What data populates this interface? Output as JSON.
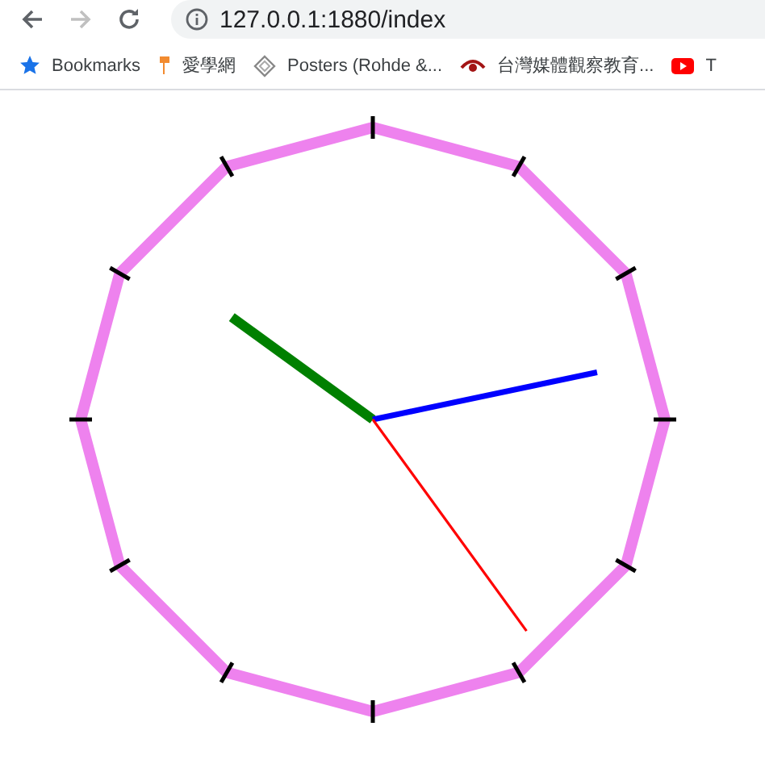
{
  "toolbar": {
    "back": {
      "disabled": false
    },
    "forward": {
      "disabled": true
    },
    "address": "127.0.0.1:1880/index"
  },
  "bookmarks": [
    {
      "kind": "star",
      "label": "Bookmarks"
    },
    {
      "kind": "pin",
      "label": "愛學網"
    },
    {
      "kind": "diamond",
      "label": "Posters (Rohde &..."
    },
    {
      "kind": "eye",
      "label": "台灣媒體觀察教育..."
    },
    {
      "kind": "video",
      "label": "T"
    }
  ],
  "clock": {
    "hands": [
      {
        "kind": "hour",
        "color": "#008000"
      },
      {
        "kind": "minute",
        "color": "#0000ff"
      },
      {
        "kind": "second",
        "color": "#ff0000"
      }
    ]
  }
}
